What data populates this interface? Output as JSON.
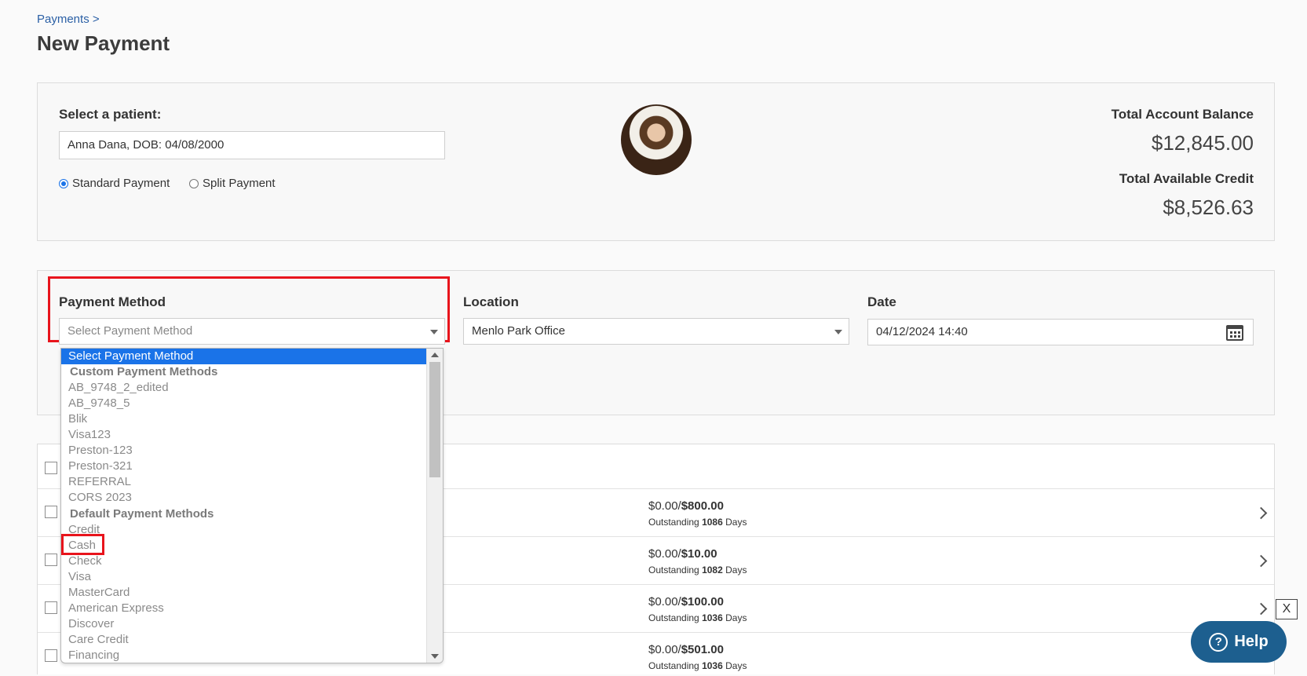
{
  "breadcrumb": "Payments >",
  "page_title": "New Payment",
  "patient": {
    "label": "Select a patient:",
    "value": "Anna Dana, DOB: 04/08/2000",
    "payment_types": [
      {
        "label": "Standard Payment",
        "checked": true
      },
      {
        "label": "Split Payment",
        "checked": false
      }
    ]
  },
  "balance": {
    "total_account_label": "Total Account Balance",
    "total_account_value": "$12,845.00",
    "total_credit_label": "Total Available Credit",
    "total_credit_value": "$8,526.63"
  },
  "payment_method": {
    "label": "Payment Method",
    "placeholder": "Select Payment Method"
  },
  "location": {
    "label": "Location",
    "value": "Menlo Park Office"
  },
  "date": {
    "label": "Date",
    "value": "04/12/2024 14:40"
  },
  "dropdown": {
    "selected": "Select Payment Method",
    "groups": [
      {
        "label": "Custom Payment Methods",
        "items": [
          "AB_9748_2_edited",
          "AB_9748_5",
          "Blik",
          "Visa123",
          "Preston-123",
          "Preston-321",
          "REFERRAL",
          "CORS 2023"
        ]
      },
      {
        "label": "Default Payment Methods",
        "items": [
          "Credit",
          "Cash",
          "Check",
          "Visa",
          "MasterCard",
          "American Express",
          "Discover",
          "Care Credit",
          "Financing"
        ]
      }
    ]
  },
  "rows": [
    {
      "amount_prefix": "$0.00/",
      "amount_total": "$800.00",
      "outstanding_label": "Outstanding",
      "days": "1086",
      "days_label": "Days"
    },
    {
      "amount_prefix": "$0.00/",
      "amount_total": "$10.00",
      "outstanding_label": "Outstanding",
      "days": "1082",
      "days_label": "Days"
    },
    {
      "amount_prefix": "$0.00/",
      "amount_total": "$100.00",
      "outstanding_label": "Outstanding",
      "days": "1036",
      "days_label": "Days"
    },
    {
      "amount_prefix": "$0.00/",
      "amount_total": "$501.00",
      "outstanding_label": "Outstanding",
      "days": "1036",
      "days_label": "Days"
    }
  ],
  "close_label": "X",
  "help": {
    "icon": "?",
    "label": "Help"
  },
  "colors": {
    "accent": "#1a73e8",
    "highlight": "#e8141c",
    "help_bg": "#1d5f8f"
  }
}
